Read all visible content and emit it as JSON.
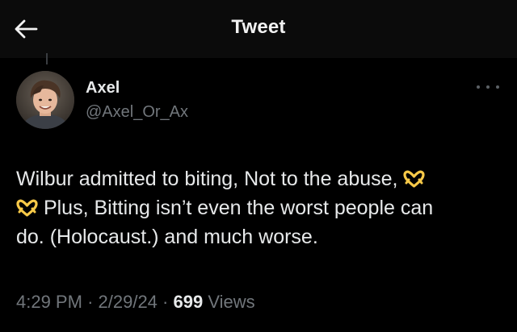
{
  "header": {
    "title": "Tweet",
    "back_icon": "arrow-left-icon"
  },
  "author": {
    "name": "Axel",
    "handle": "@Axel_Or_Ax",
    "avatar": "avatar-photo"
  },
  "more_icon": "more-horizontal-icon",
  "tweet": {
    "line1_text": "Wilbur admitted to biting, Not to the abuse,",
    "line2_text": "Plus, Bitting isn’t even the worst people can",
    "line3_text": "do. (Holocaust.) and much worse.",
    "emoji": "heart-hands-emoji",
    "emoji_color": "#f7c948"
  },
  "meta": {
    "time": "4:29 PM",
    "separator": "·",
    "date": "2/29/24",
    "views_count": "699",
    "views_label": "Views"
  },
  "colors": {
    "background": "#000000",
    "primary_text": "#e7e9ea",
    "secondary_text": "#71767b"
  }
}
